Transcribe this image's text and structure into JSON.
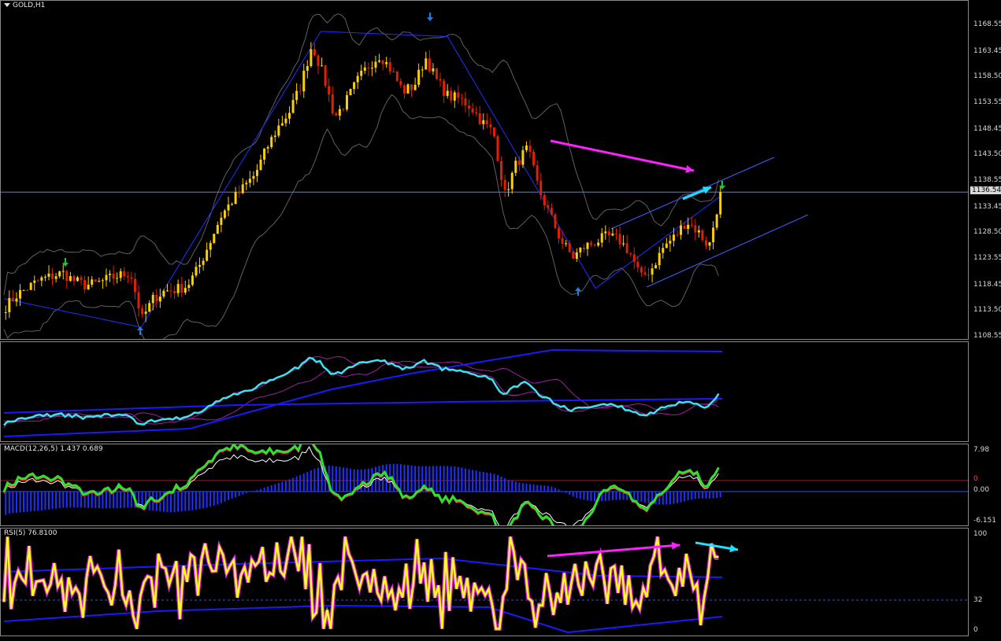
{
  "window": {
    "symbol_label": "GOLD,H1"
  },
  "main": {
    "y_ticks": [
      "1168.55",
      "1163.45",
      "1158.50",
      "1153.55",
      "1148.45",
      "1143.50",
      "1138.55",
      "1133.45",
      "1128.50",
      "1123.55",
      "1118.45",
      "1113.50",
      "1108.55"
    ],
    "current_price": "1136.54",
    "colors": {
      "bull": "#ffd000",
      "bear": "#e02000",
      "zigzag": "#2030ff",
      "channel": "#4060ff",
      "bands": "#606060",
      "arrow_magenta": "#ff20ff",
      "arrow_cyan": "#20e0ff",
      "signal_up": "#1e7fe0",
      "signal_down": "#1e7fe0"
    }
  },
  "macd": {
    "label": "MACD(12,26,5) 1.437 0.689",
    "ticks": [
      "7.98",
      "0.00",
      "-6.151"
    ],
    "marker": "0"
  },
  "rsi": {
    "label": "RSI(5) 76.8100",
    "ticks": [
      "100",
      "32",
      "0"
    ]
  },
  "chart_data": [
    {
      "type": "candlestick",
      "title": "GOLD,H1",
      "ylim": [
        1108.55,
        1168.55
      ],
      "close_path": [
        1114.5,
        1116.8,
        1118.2,
        1119.6,
        1120.3,
        1121.0,
        1119.5,
        1118.6,
        1118.9,
        1119.8,
        1120.5,
        1121.0,
        1112.0,
        1116.0,
        1117.5,
        1117.8,
        1118.5,
        1122.0,
        1127.0,
        1132.0,
        1135.0,
        1137.5,
        1140.0,
        1145.0,
        1149.0,
        1152.0,
        1157.0,
        1165.0,
        1159.0,
        1151.0,
        1154.0,
        1158.0,
        1161.0,
        1163.0,
        1160.0,
        1156.0,
        1157.0,
        1162.5,
        1158.0,
        1155.0,
        1154.5,
        1153.0,
        1150.0,
        1148.0,
        1136.0,
        1142.0,
        1145.0,
        1137.0,
        1132.0,
        1127.0,
        1124.0,
        1126.0,
        1127.0,
        1128.0,
        1127.5,
        1125.0,
        1120.0,
        1122.0,
        1126.0,
        1128.0,
        1131.0,
        1129.0,
        1126.0,
        1136.5
      ],
      "current_price": 1136.54,
      "zigzag": [
        [
          0,
          1116.0
        ],
        [
          13,
          1110.5
        ],
        [
          30,
          1167.5
        ],
        [
          42,
          1166.5
        ],
        [
          56,
          1118.0
        ],
        [
          68,
          1136.0
        ]
      ]
    },
    {
      "type": "line",
      "title": "MACD(12,26,5) 1.437 0.689",
      "ylim": [
        -6.151,
        7.98
      ],
      "values": {
        "macd": 1.437,
        "signal": 0.689
      }
    },
    {
      "type": "line",
      "title": "RSI(5) 76.8100",
      "ylim": [
        0,
        100
      ],
      "levels": [
        32
      ],
      "value": 76.81
    }
  ]
}
